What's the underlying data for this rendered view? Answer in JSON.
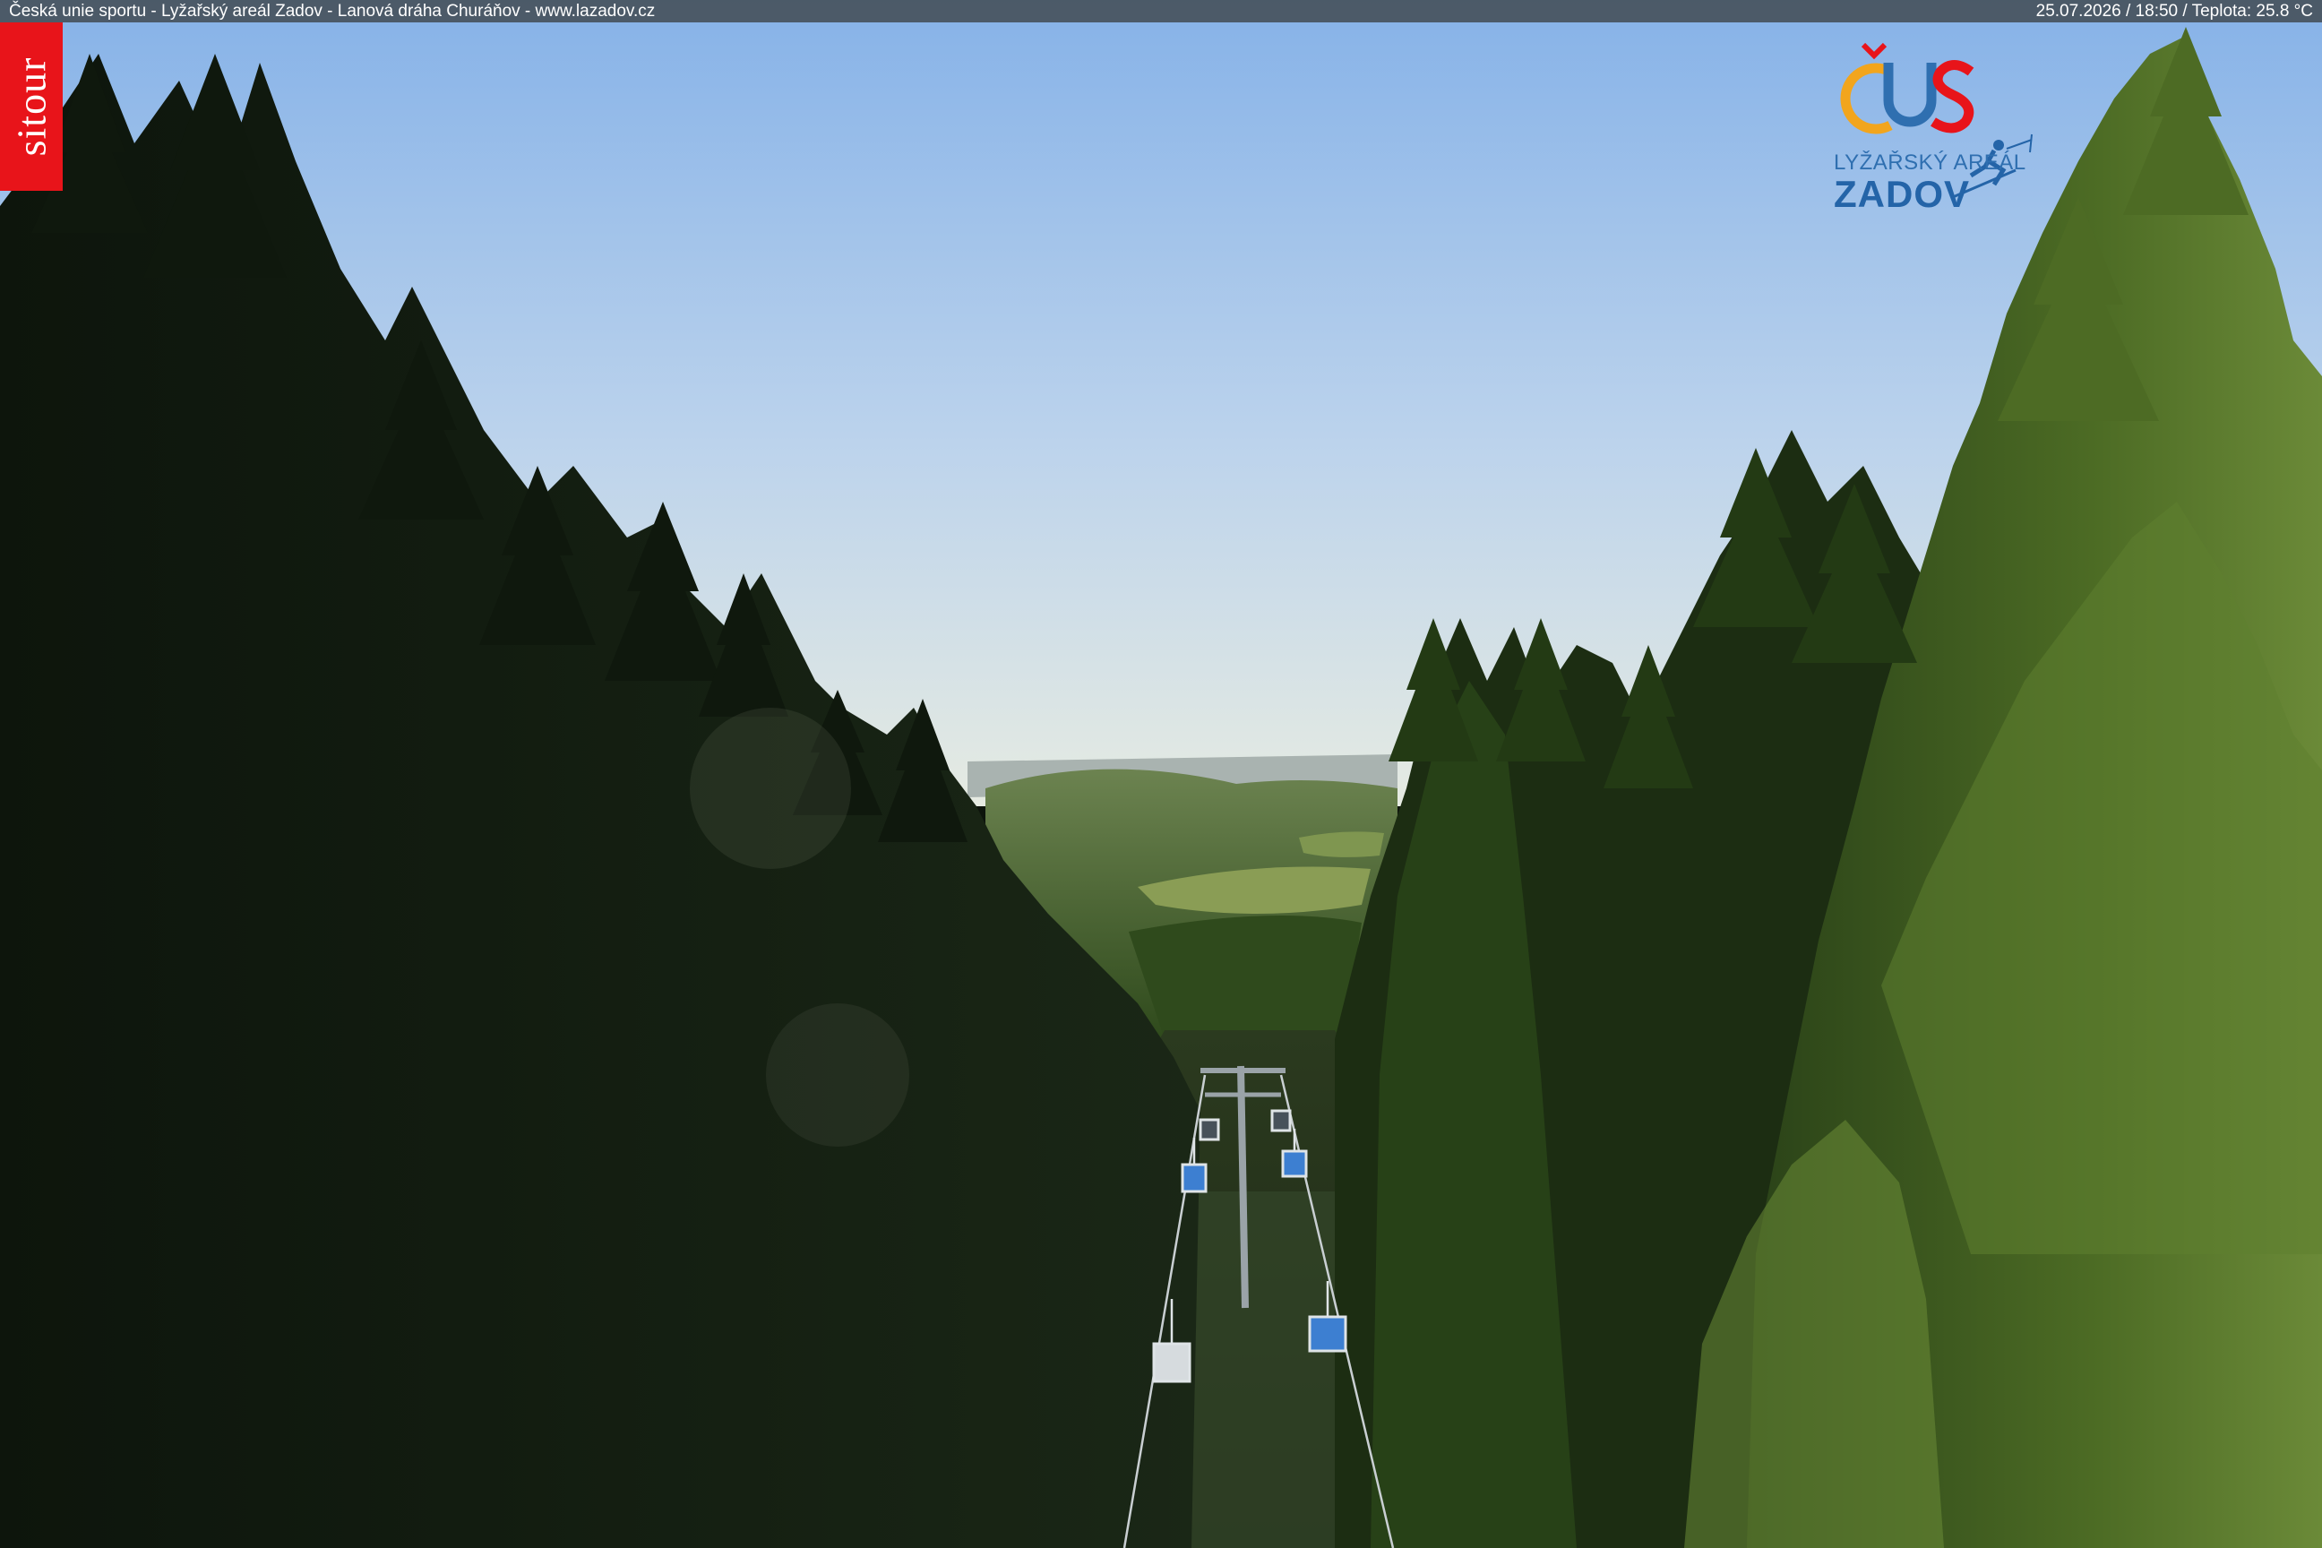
{
  "header": {
    "caption": "Česká unie sportu - Lyžařský areál Zadov - Lanová dráha Churáňov - www.lazadov.cz",
    "status": "25.07.2026 / 18:50 / Teplota: 25.8 °C"
  },
  "badge": {
    "label": "sitour",
    "color": "#e8141a"
  },
  "logo": {
    "mark": "ČUS",
    "area": "LYŽAŘSKÝ AREÁL",
    "name": "ZADOV",
    "icon": "skier-icon"
  },
  "colors": {
    "sky_top": "#8cb6e9",
    "sky_horizon": "#e4e9e3",
    "forest_dark": "#111c0f",
    "forest_lit": "#5b7a2d",
    "chair": "#3d7fd1"
  }
}
